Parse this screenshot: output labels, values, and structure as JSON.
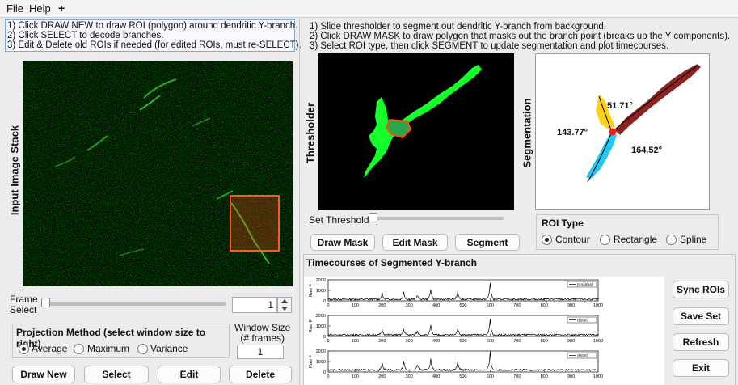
{
  "menu": {
    "file": "File",
    "help": "Help",
    "add": "+"
  },
  "left": {
    "instructions": [
      "1) Click DRAW NEW to draw ROI (polygon) around dendritic Y-branch.",
      "2) Click SELECT to decode branches.",
      "3) Edit & Delete old ROIs if needed (for edited ROIs, must re-SELECT)."
    ],
    "stack_label": "Input Image Stack",
    "frame_select_label": "Frame\nSelect",
    "frame_value": "1",
    "projection_title": "Projection Method (select window size to right)",
    "projection_options": [
      "Average",
      "Maximum",
      "Variance"
    ],
    "projection_selected": "Average",
    "window_size_label": "Window Size\n(# frames)",
    "window_size_value": "1",
    "buttons": {
      "draw_new": "Draw New",
      "select": "Select",
      "edit": "Edit",
      "delete": "Delete"
    }
  },
  "right": {
    "instructions": [
      "1) Slide thresholder to segment out dendritic Y-branch from background.",
      "2) Click DRAW MASK to draw polygon that masks out the branch point (breaks up the Y components).",
      "3) Select ROI type, then click SEGMENT to update segmentation and plot timecourses."
    ],
    "thresholder_label": "Thresholder",
    "segmentation_label": "Segmentation",
    "set_threshold_label": "Set Threshold",
    "buttons": {
      "draw_mask": "Draw Mask",
      "edit_mask": "Edit Mask",
      "segment": "Segment"
    },
    "angles": {
      "a1": "51.71°",
      "a2": "143.77°",
      "a3": "164.52°"
    },
    "roi_type_title": "ROI Type",
    "roi_options": [
      "Contour",
      "Rectangle",
      "Spline"
    ],
    "roi_selected": "Contour"
  },
  "timecourses": {
    "title": "Timecourses of Segmented Y-branch",
    "side_buttons": {
      "sync": "Sync ROIs",
      "save": "Save Set",
      "refresh": "Refresh",
      "exit": "Exit"
    }
  },
  "chart_data": [
    {
      "type": "line",
      "series": [
        {
          "name": "proximal"
        }
      ],
      "ylabel": "Raw F",
      "ylim": [
        0,
        2000
      ],
      "yticks": [
        0,
        1000,
        2000
      ],
      "xlim": [
        0,
        1000
      ],
      "xticks": [
        0,
        100,
        200,
        300,
        400,
        500,
        600,
        700,
        800,
        900,
        1000
      ],
      "peaks": [
        [
          200,
          600
        ],
        [
          280,
          700
        ],
        [
          330,
          400
        ],
        [
          380,
          1000
        ],
        [
          480,
          750
        ],
        [
          600,
          1600
        ]
      ],
      "baseline": 150
    },
    {
      "type": "line",
      "series": [
        {
          "name": "distal1"
        }
      ],
      "ylabel": "Raw F",
      "ylim": [
        0,
        2000
      ],
      "yticks": [
        0,
        1000,
        2000
      ],
      "xlim": [
        0,
        1000
      ],
      "xticks": [
        0,
        100,
        200,
        300,
        400,
        500,
        600,
        700,
        800,
        900,
        1000
      ],
      "peaks": [
        [
          200,
          500
        ],
        [
          280,
          550
        ],
        [
          330,
          350
        ],
        [
          380,
          900
        ],
        [
          480,
          700
        ],
        [
          600,
          1500
        ]
      ],
      "baseline": 150
    },
    {
      "type": "line",
      "series": [
        {
          "name": "distal2"
        }
      ],
      "ylabel": "Raw F",
      "ylim": [
        0,
        2000
      ],
      "yticks": [
        0,
        1000,
        2000
      ],
      "xlim": [
        0,
        1000
      ],
      "xticks": [
        0,
        100,
        200,
        300,
        400,
        500,
        600,
        700,
        800,
        900,
        1000
      ],
      "peaks": [
        [
          200,
          700
        ],
        [
          280,
          800
        ],
        [
          330,
          500
        ],
        [
          380,
          1100
        ],
        [
          480,
          800
        ],
        [
          600,
          1700
        ]
      ],
      "baseline": 200
    }
  ]
}
